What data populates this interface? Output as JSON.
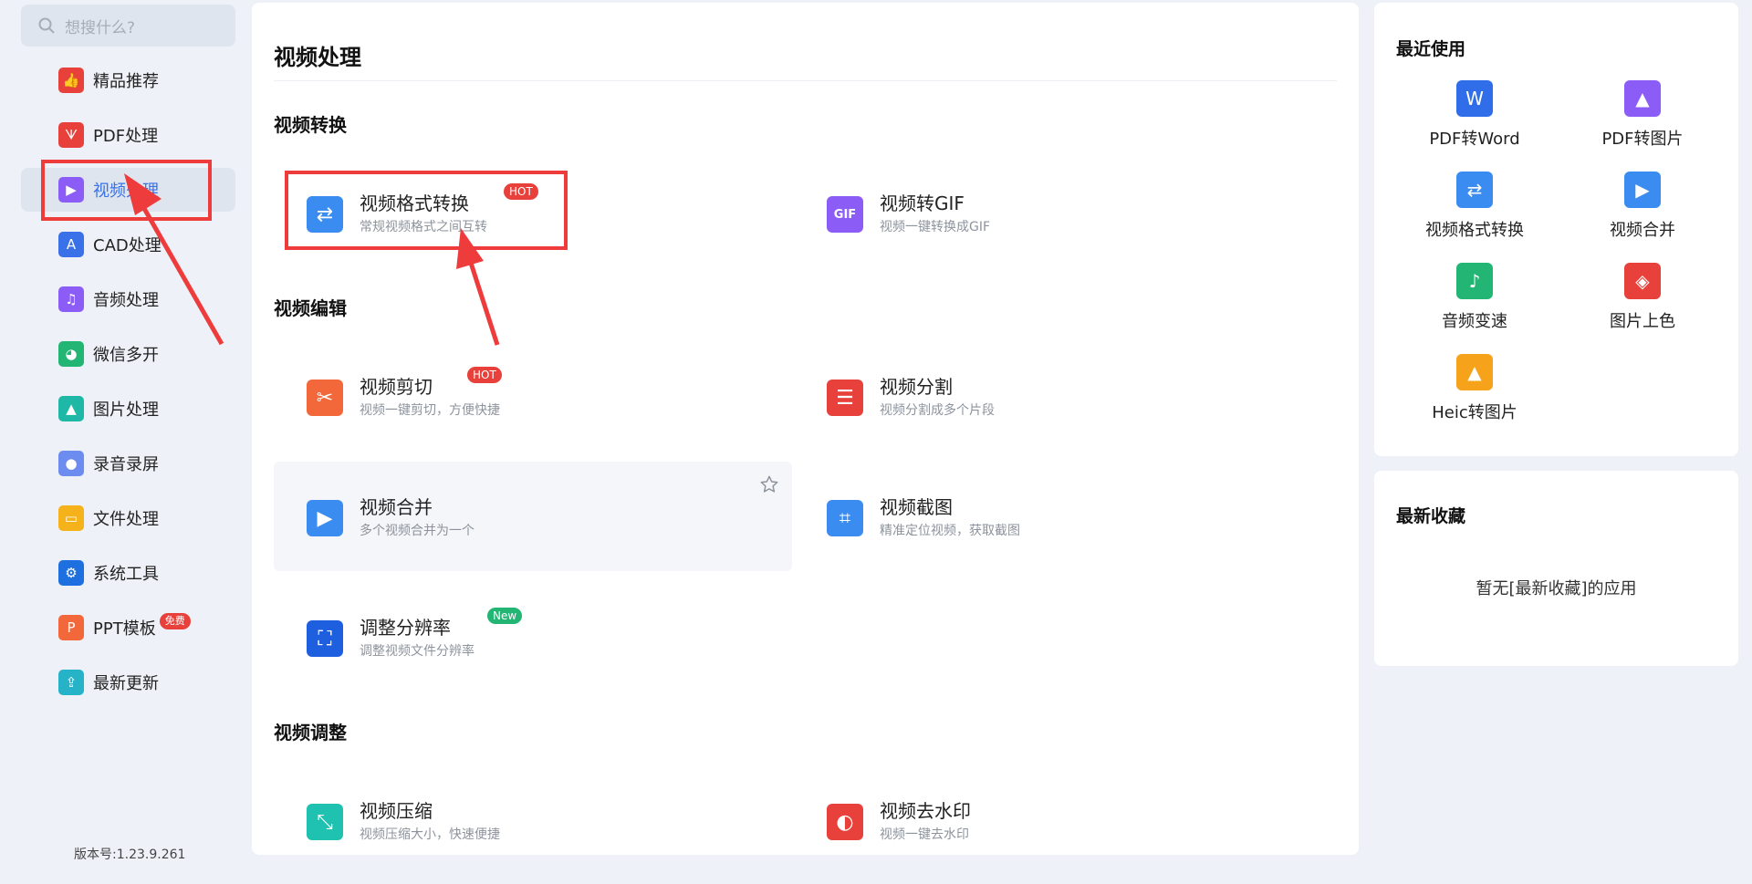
{
  "search": {
    "placeholder": "想搜什么?"
  },
  "sidebar": {
    "items": [
      {
        "label": "精品推荐",
        "icon": "thumbs-up-icon",
        "color": "#e8413b"
      },
      {
        "label": "PDF处理",
        "icon": "pdf-icon",
        "color": "#e8413b"
      },
      {
        "label": "视频处理",
        "icon": "video-play-icon",
        "color": "#8b5cf6",
        "active": true
      },
      {
        "label": "CAD处理",
        "icon": "cad-icon",
        "color": "#3a71e8"
      },
      {
        "label": "音频处理",
        "icon": "music-note-icon",
        "color": "#8b5cf6"
      },
      {
        "label": "微信多开",
        "icon": "wechat-icon",
        "color": "#22b573"
      },
      {
        "label": "图片处理",
        "icon": "image-icon",
        "color": "#1fb8a6"
      },
      {
        "label": "录音录屏",
        "icon": "microphone-icon",
        "color": "#6d8cf0"
      },
      {
        "label": "文件处理",
        "icon": "folder-icon",
        "color": "#f6b21b"
      },
      {
        "label": "系统工具",
        "icon": "gear-icon",
        "color": "#1e6fe0"
      },
      {
        "label": "PPT模板",
        "icon": "ppt-icon",
        "color": "#f2683a",
        "badge": "免费"
      },
      {
        "label": "最新更新",
        "icon": "upload-icon",
        "color": "#27b3c7"
      }
    ],
    "version": "版本号:1.23.9.261"
  },
  "main": {
    "title": "视频处理",
    "sections": [
      {
        "title": "视频转换"
      },
      {
        "title": "视频编辑"
      },
      {
        "title": "视频调整"
      }
    ],
    "cards": [
      {
        "title": "视频格式转换",
        "desc": "常规视频格式之间互转",
        "badge": "HOT",
        "icon": "convert-arrows-icon"
      },
      {
        "title": "视频转GIF",
        "desc": "视频一键转换成GIF",
        "icon": "gif-icon"
      },
      {
        "title": "视频剪切",
        "desc": "视频一键剪切，方便快捷",
        "badge": "HOT",
        "icon": "scissors-video-icon"
      },
      {
        "title": "视频分割",
        "desc": "视频分割成多个片段",
        "icon": "split-icon"
      },
      {
        "title": "视频合并",
        "desc": "多个视频合并为一个",
        "icon": "merge-video-icon"
      },
      {
        "title": "视频截图",
        "desc": "精准定位视频，获取截图",
        "icon": "crop-screenshot-icon"
      },
      {
        "title": "调整分辨率",
        "desc": "调整视频文件分辨率",
        "badge": "New",
        "icon": "resolution-icon"
      },
      {
        "title": "视频压缩",
        "desc": "视频压缩大小，快速便捷",
        "icon": "compress-icon"
      },
      {
        "title": "视频去水印",
        "desc": "视频一键去水印",
        "icon": "eraser-icon"
      }
    ]
  },
  "recent": {
    "title": "最近使用",
    "items": [
      {
        "label": "PDF转Word",
        "icon": "pdf-to-word-icon",
        "color": "#2f6ee8"
      },
      {
        "label": "PDF转图片",
        "icon": "pdf-to-image-icon",
        "color": "#8b5cf6"
      },
      {
        "label": "视频格式转换",
        "icon": "convert-arrows-icon",
        "color": "#3a8cf0"
      },
      {
        "label": "视频合并",
        "icon": "merge-video-icon",
        "color": "#3a8cf0"
      },
      {
        "label": "音频变速",
        "icon": "audio-speed-icon",
        "color": "#22b573"
      },
      {
        "label": "图片上色",
        "icon": "paint-bucket-icon",
        "color": "#e8413b"
      },
      {
        "label": "Heic转图片",
        "icon": "heic-image-icon",
        "color": "#f6a21b"
      }
    ]
  },
  "favorites": {
    "title": "最新收藏",
    "empty": "暂无[最新收藏]的应用"
  }
}
